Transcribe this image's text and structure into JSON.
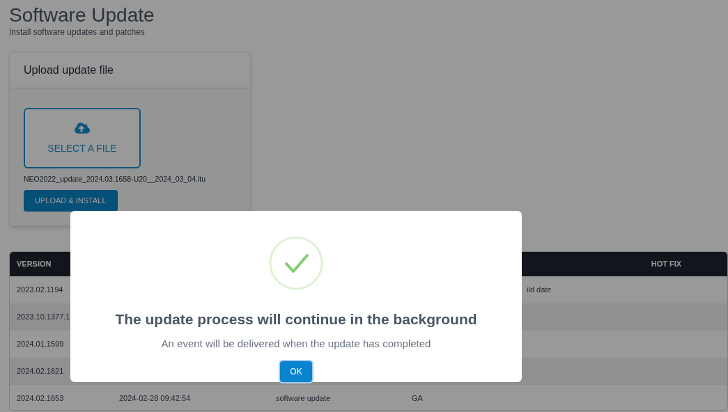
{
  "page": {
    "title": "Software Update",
    "subtitle": "Install software updates and patches"
  },
  "upload_card": {
    "title": "Upload update file",
    "select_button": "SELECT A FILE",
    "file_name": "NEO2022_update_2024.03.1658-U20__2024_03_04.itu",
    "upload_button": "UPLOAD & INSTALL"
  },
  "table": {
    "columns": {
      "version": "VERSION",
      "hot_fix": "HOT FIX"
    },
    "rows": [
      {
        "version": "2023.02.1194",
        "column_5": "ild date"
      },
      {
        "version": "2023.10.1377.1"
      },
      {
        "version": "2024.01.1599"
      },
      {
        "version": "2024.02.1621"
      },
      {
        "version": "2024.02.1653",
        "column_2": "2024-02-28 09:42:54",
        "column_3": "software update",
        "column_4": "GA"
      }
    ]
  },
  "dialog": {
    "title": "The update process will continue in the background",
    "message": "An event will be delivered when the update has completed",
    "ok_button": "OK"
  }
}
